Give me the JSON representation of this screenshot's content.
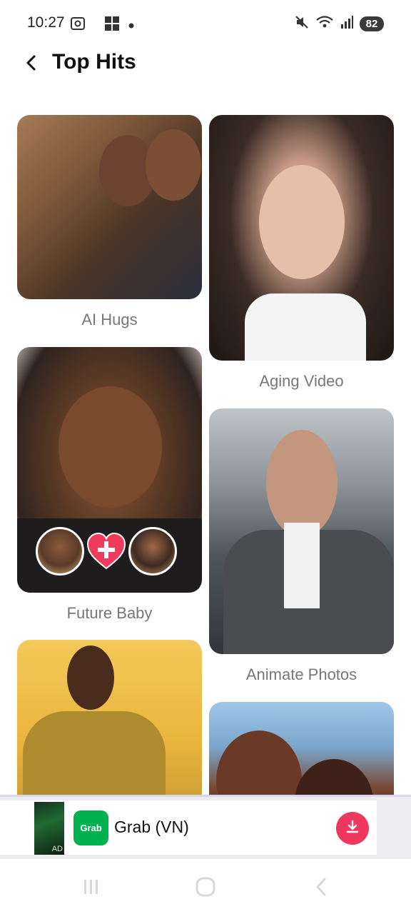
{
  "status_bar": {
    "time": "10:27",
    "battery": "82",
    "icons": [
      "screenshot-icon",
      "app-grid-icon",
      "dot-icon",
      "mute-icon",
      "wifi-icon",
      "signal-icon"
    ]
  },
  "header": {
    "title": "Top Hits",
    "back_icon": "back-arrow-icon"
  },
  "cards": [
    {
      "label": "AI Hugs"
    },
    {
      "label": "Aging Video"
    },
    {
      "label": "Future Baby"
    },
    {
      "label": "Animate Photos"
    }
  ],
  "ad": {
    "thumb_label": "AD",
    "logo_text": "Grab",
    "title": "Grab (VN)",
    "brand_color": "#00b14f",
    "download_color": "#f0375f"
  },
  "nav": {
    "icons": [
      "recents-icon",
      "home-icon",
      "back-icon"
    ]
  }
}
